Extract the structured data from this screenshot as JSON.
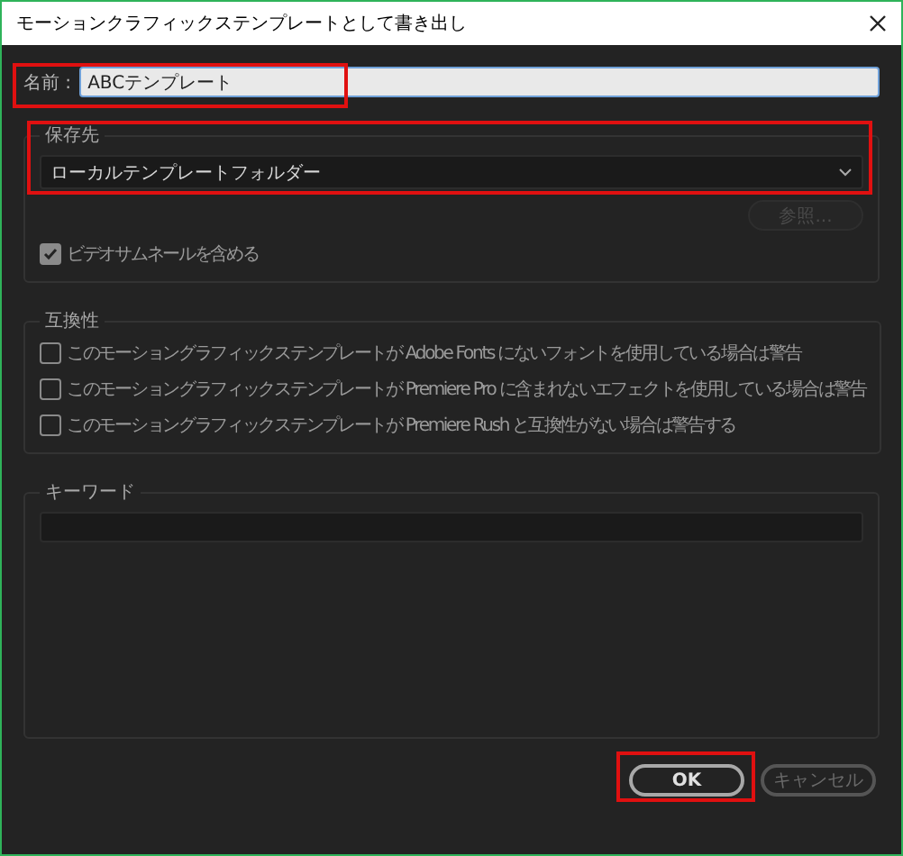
{
  "window": {
    "title": "モーションクラフィックステンプレートとして書き出し"
  },
  "name_field": {
    "label": "名前 :",
    "value": "ABCテンプレート"
  },
  "destination": {
    "legend": "保存先",
    "dropdown": "ローカルテンプレートフォルダー",
    "browse": {
      "label": "参照...",
      "disabled": true
    },
    "thumbnail": {
      "label": "ビデオサムネールを含める",
      "checked": true
    }
  },
  "compatibility": {
    "legend": "互換性",
    "options": [
      {
        "label": "このモーショングラフィックステンプレートが Adobe Fonts にないフォントを使用している場合は警告",
        "checked": false
      },
      {
        "label": "このモーショングラフィックステンプレートが Premiere Pro に含まれないエフェクトを使用している場合は警告",
        "checked": false
      },
      {
        "label": "このモーショングラフィックステンプレートが Premiere Rush と互換性がない場合は警告する",
        "checked": false
      }
    ]
  },
  "keywords": {
    "legend": "キーワード"
  },
  "buttons": [
    {
      "label": "OK",
      "kind": "primary"
    },
    {
      "label": "キャンセル",
      "kind": "secondary"
    }
  ]
}
